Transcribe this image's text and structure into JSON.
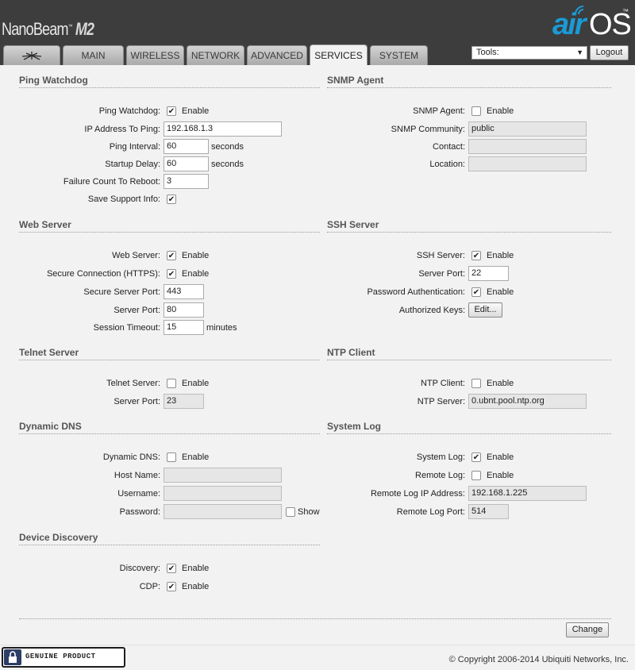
{
  "header": {
    "product_name": "NanoBeam",
    "product_tm": "™",
    "product_model": "M2",
    "logo_air": "air",
    "logo_os": "OS",
    "logo_tm": "™",
    "tabs": [
      {
        "label": "",
        "icon": "ubiquiti-logo-icon"
      },
      {
        "label": "MAIN"
      },
      {
        "label": "WIRELESS"
      },
      {
        "label": "NETWORK"
      },
      {
        "label": "ADVANCED"
      },
      {
        "label": "SERVICES",
        "active": true
      },
      {
        "label": "SYSTEM"
      }
    ],
    "tools_value": "Tools:",
    "logout_label": "Logout"
  },
  "ping_watchdog": {
    "title": "Ping Watchdog",
    "enable_label": "Ping Watchdog:",
    "enable_text": "Enable",
    "enable_checked": true,
    "ip_label": "IP Address To Ping:",
    "ip_value": "192.168.1.3",
    "interval_label": "Ping Interval:",
    "interval_value": "60",
    "interval_unit": "seconds",
    "startup_label": "Startup Delay:",
    "startup_value": "60",
    "startup_unit": "seconds",
    "failure_label": "Failure Count To Reboot:",
    "failure_value": "3",
    "support_label": "Save Support Info:",
    "support_checked": true
  },
  "snmp": {
    "title": "SNMP Agent",
    "agent_label": "SNMP Agent:",
    "agent_text": "Enable",
    "agent_checked": false,
    "community_label": "SNMP Community:",
    "community_value": "public",
    "contact_label": "Contact:",
    "contact_value": "",
    "location_label": "Location:",
    "location_value": ""
  },
  "web_server": {
    "title": "Web Server",
    "server_label": "Web Server:",
    "server_text": "Enable",
    "server_checked": true,
    "https_label": "Secure Connection (HTTPS):",
    "https_text": "Enable",
    "https_checked": true,
    "secure_port_label": "Secure Server Port:",
    "secure_port_value": "443",
    "port_label": "Server Port:",
    "port_value": "80",
    "timeout_label": "Session Timeout:",
    "timeout_value": "15",
    "timeout_unit": "minutes"
  },
  "ssh": {
    "title": "SSH Server",
    "server_label": "SSH Server:",
    "server_text": "Enable",
    "server_checked": true,
    "port_label": "Server Port:",
    "port_value": "22",
    "password_label": "Password Authentication:",
    "password_text": "Enable",
    "password_checked": true,
    "keys_label": "Authorized Keys:",
    "keys_button": "Edit..."
  },
  "telnet": {
    "title": "Telnet Server",
    "server_label": "Telnet Server:",
    "server_text": "Enable",
    "server_checked": false,
    "port_label": "Server Port:",
    "port_value": "23"
  },
  "ntp": {
    "title": "NTP Client",
    "client_label": "NTP Client:",
    "client_text": "Enable",
    "client_checked": false,
    "server_label": "NTP Server:",
    "server_value": "0.ubnt.pool.ntp.org"
  },
  "ddns": {
    "title": "Dynamic DNS",
    "enable_label": "Dynamic DNS:",
    "enable_text": "Enable",
    "enable_checked": false,
    "host_label": "Host Name:",
    "host_value": "",
    "user_label": "Username:",
    "user_value": "",
    "pass_label": "Password:",
    "pass_value": "",
    "show_text": "Show",
    "show_checked": false
  },
  "syslog": {
    "title": "System Log",
    "log_label": "System Log:",
    "log_text": "Enable",
    "log_checked": true,
    "remote_label": "Remote Log:",
    "remote_text": "Enable",
    "remote_checked": false,
    "remote_ip_label": "Remote Log IP Address:",
    "remote_ip_value": "192.168.1.225",
    "remote_port_label": "Remote Log Port:",
    "remote_port_value": "514"
  },
  "discovery": {
    "title": "Device Discovery",
    "discovery_label": "Discovery:",
    "discovery_text": "Enable",
    "discovery_checked": true,
    "cdp_label": "CDP:",
    "cdp_text": "Enable",
    "cdp_checked": true
  },
  "change_button": "Change",
  "footer": {
    "badge_text": "GENUINE   PRODUCT",
    "copyright": "© Copyright 2006-2014 Ubiquiti Networks, Inc."
  },
  "colors": {
    "header_bg": "#3d3d3d",
    "content_bg": "#f2f2f2",
    "logo_blue": "#1a9ad6"
  }
}
